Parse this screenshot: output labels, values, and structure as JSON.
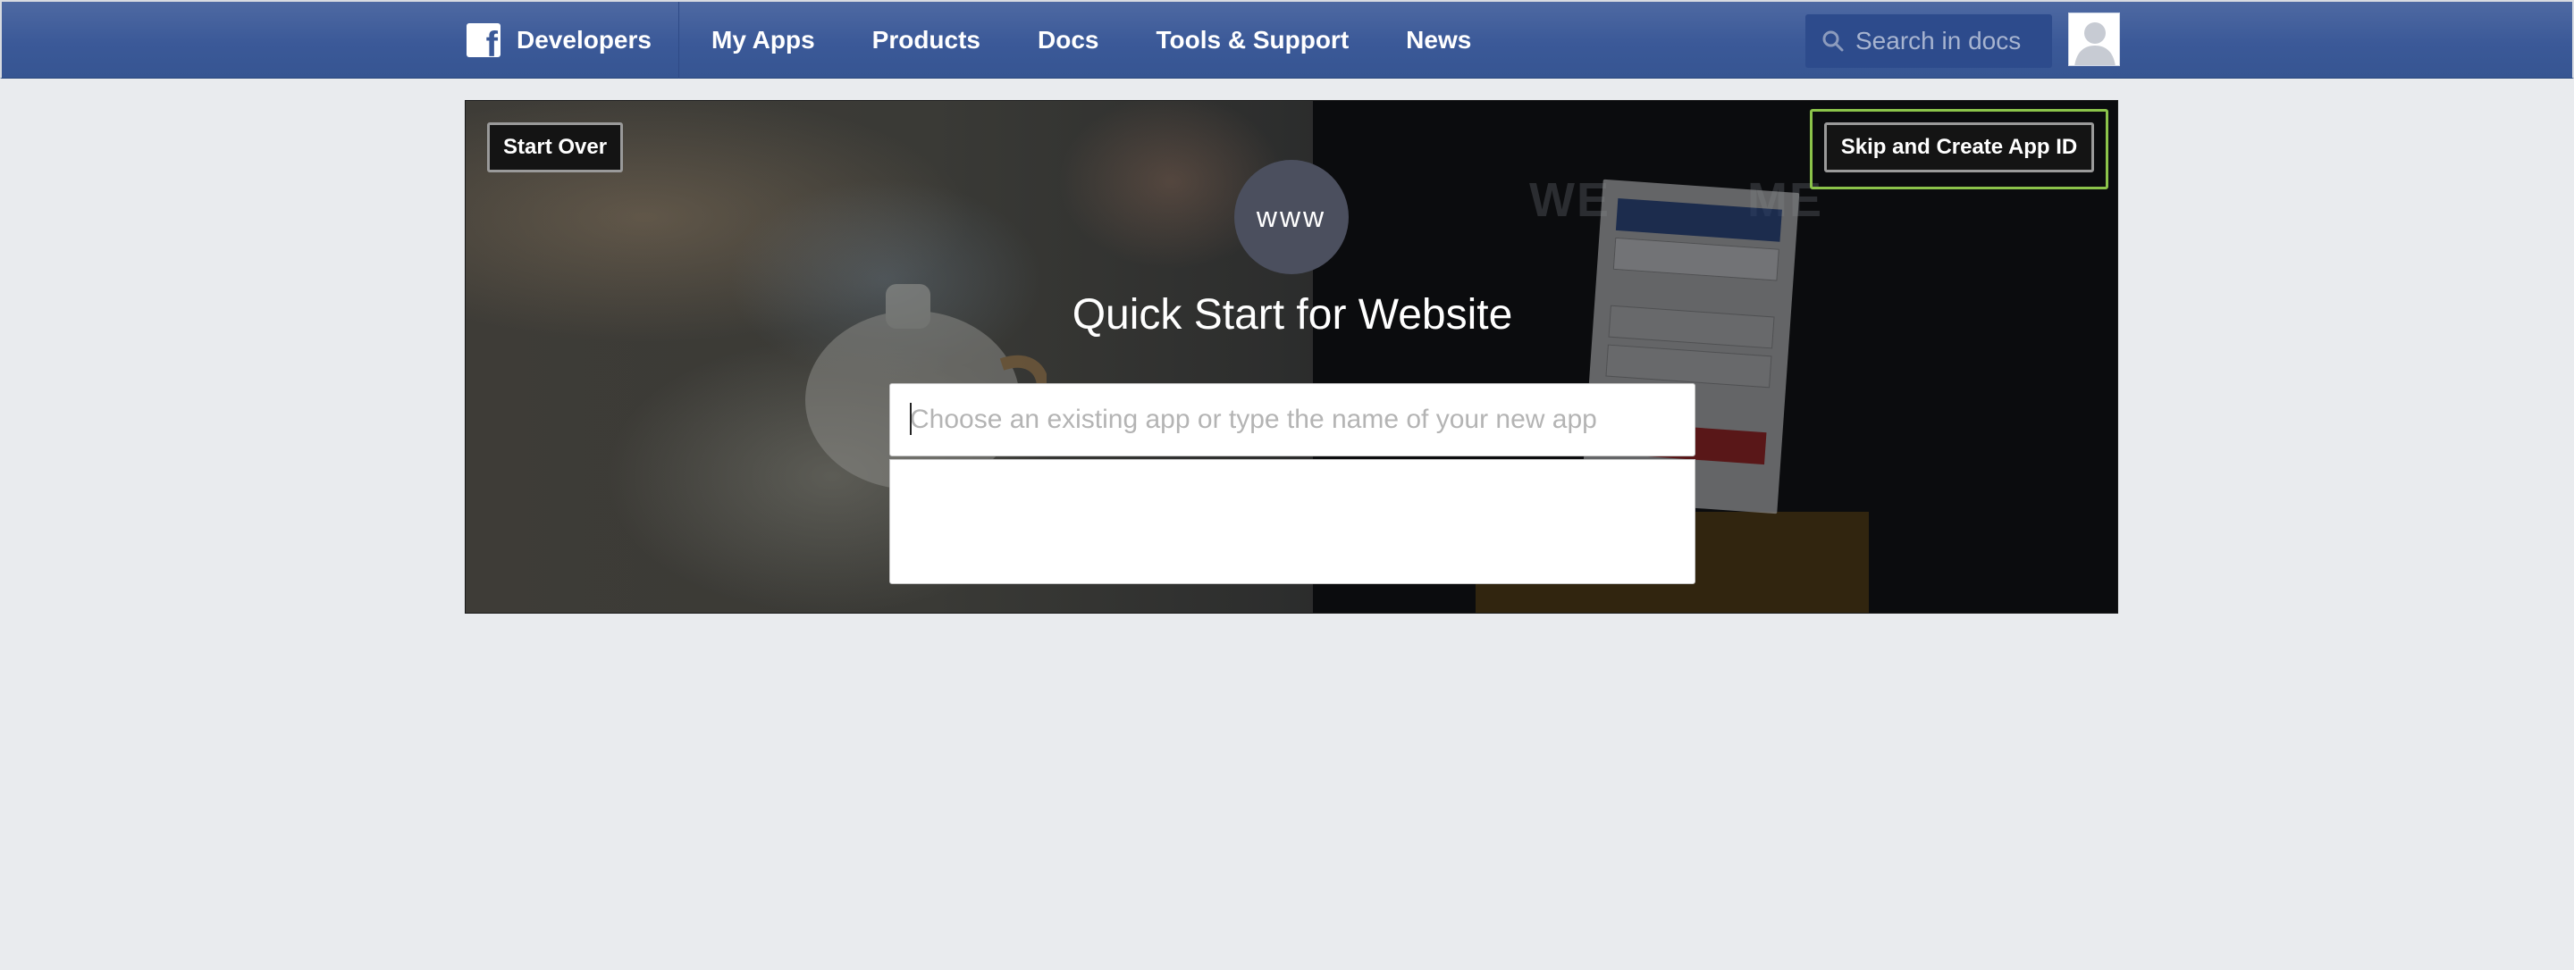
{
  "nav": {
    "brand": "Developers",
    "items": [
      "My Apps",
      "Products",
      "Docs",
      "Tools & Support",
      "News"
    ],
    "search_placeholder": "Search in docs"
  },
  "hero": {
    "start_over": "Start Over",
    "skip_create": "Skip and Create App ID",
    "badge": "www",
    "title": "Quick Start for Website",
    "input_placeholder": "Choose an existing app or type the name of your new app",
    "input_value": ""
  },
  "colors": {
    "nav_bg": "#3b5998",
    "page_bg": "#e9ebee",
    "focus_ring": "#8bc34a",
    "badge_bg": "#4b4f5e"
  },
  "icons": {
    "brand": "facebook-logo-icon",
    "search": "search-icon",
    "avatar": "user-avatar-icon"
  }
}
